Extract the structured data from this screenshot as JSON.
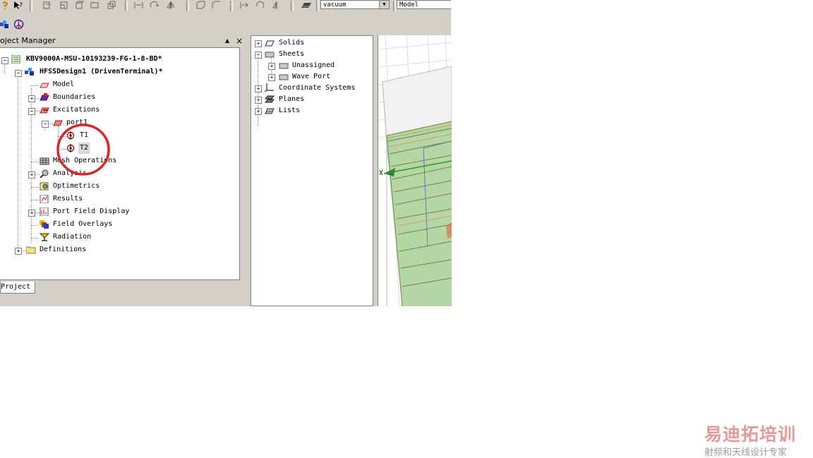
{
  "toolbar": {
    "material_combo": "vacuum",
    "view_combo": "Model"
  },
  "project_manager": {
    "title": "oject Manager",
    "pin_glyph": "▲",
    "close_glyph": "×",
    "tab_label": "Project",
    "tree": {
      "project": "KBV9000A-MSU-10193239-FG-1-8-BD*",
      "design": "HFSSDesign1 (DrivenTerminal)*",
      "model": "Model",
      "boundaries": "Boundaries",
      "excitations": "Excitations",
      "port": "port1",
      "t1": "T1",
      "t2": "T2",
      "mesh": "Mesh Operations",
      "analysis": "Analysis",
      "optimetrics": "Optimetrics",
      "results": "Results",
      "port_field": "Port Field Display",
      "field_overlays": "Field Overlays",
      "radiation": "Radiation",
      "definitions": "Definitions"
    }
  },
  "model_tree": {
    "solids": "Solids",
    "sheets": "Sheets",
    "unassigned": "Unassigned",
    "wave_port": "Wave Port",
    "coord": "Coordinate Systems",
    "planes": "Planes",
    "lists": "Lists"
  },
  "viewport": {
    "axis_label": "X"
  },
  "watermark": {
    "logo": "易迪拓培训",
    "sub": "射频和天线设计专家"
  },
  "colors": {
    "highlight_circle": "#d9262b",
    "chrome": "#d4d0c8",
    "model_green": "#7fb26a"
  }
}
